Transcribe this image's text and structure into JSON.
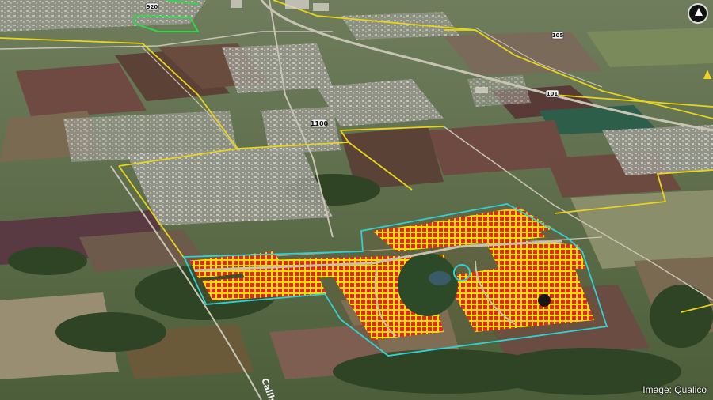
{
  "map": {
    "road_labels": {
      "fm1100": "1100",
      "fm920": "920",
      "cr101": "101",
      "cr105": "105",
      "callis_rd": "Callis"
    },
    "credit": "Image: Qualico",
    "colors": {
      "parcel_boundary": "#e8d41a",
      "site_boundary": "#2fd2d2",
      "lot_lines": "#f0e000",
      "lot_fill": "#e0281c",
      "greenway": "#6a8a4a"
    },
    "icons": {
      "compass": "compass-icon",
      "placemark": "placemark-icon"
    }
  }
}
